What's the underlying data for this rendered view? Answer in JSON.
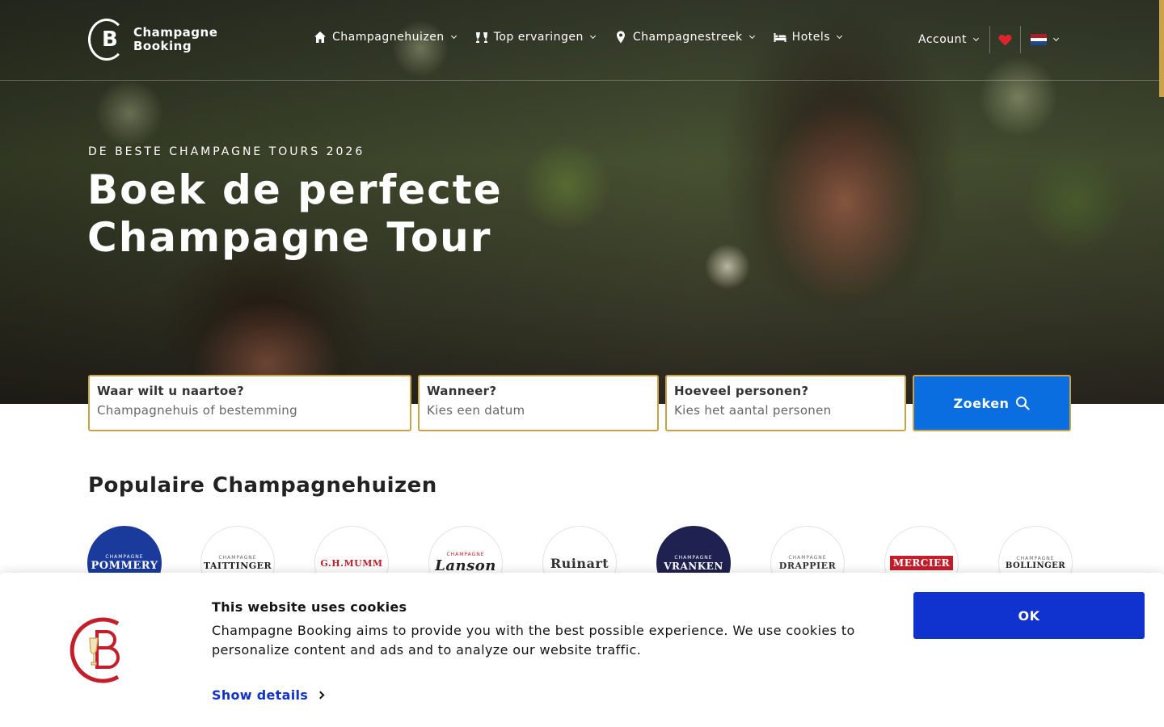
{
  "header": {
    "logo_line1": "Champagne",
    "logo_line2": "Booking",
    "nav": [
      {
        "label": "Champagnehuizen",
        "icon": "home-icon"
      },
      {
        "label": "Top ervaringen",
        "icon": "glasses-icon"
      },
      {
        "label": "Champagnestreek",
        "icon": "map-pin-icon"
      },
      {
        "label": "Hotels",
        "icon": "bed-icon"
      }
    ],
    "account_label": "Account",
    "language_flag": "nl-flag-icon"
  },
  "hero": {
    "eyebrow": "DE BESTE CHAMPAGNE TOURS 2026",
    "headline": "Boek de perfecte Champagne Tour"
  },
  "search": {
    "where_label": "Waar wilt u naartoe?",
    "where_placeholder": "Champagnehuis of bestemming",
    "when_label": "Wanneer?",
    "when_placeholder": "Kies een datum",
    "people_label": "Hoeveel personen?",
    "people_placeholder": "Kies het aantal personen",
    "button_label": "Zoeken"
  },
  "popular": {
    "title": "Populaire Champagnehuizen",
    "houses": [
      {
        "small": "CHAMPAGNE",
        "name": "POMMERY"
      },
      {
        "small": "CHAMPAGNE",
        "name": "TAITTINGER"
      },
      {
        "small": "",
        "name": "G.H.MUMM"
      },
      {
        "small": "CHAMPAGNE",
        "name": "Lanson"
      },
      {
        "small": "",
        "name": "Ruinart"
      },
      {
        "small": "CHAMPAGNE",
        "name": "VRANKEN"
      },
      {
        "small": "CHAMPAGNE",
        "name": "DRAPPIER"
      },
      {
        "small": "",
        "name": "MERCIER"
      },
      {
        "small": "CHAMPAGNE",
        "name": "BOLLINGER"
      }
    ]
  },
  "cookie": {
    "title": "This website uses cookies",
    "text": "Champagne Booking aims to provide you with the best possible experience. We use cookies to personalize content and ads and to analyze our website traffic.",
    "details_link": "Show details",
    "ok_button": "OK"
  },
  "colors": {
    "accent_gold": "#c9a24a",
    "search_blue": "#0a6de0",
    "cookie_blue": "#1032cf",
    "heart_red": "#e0242e"
  }
}
